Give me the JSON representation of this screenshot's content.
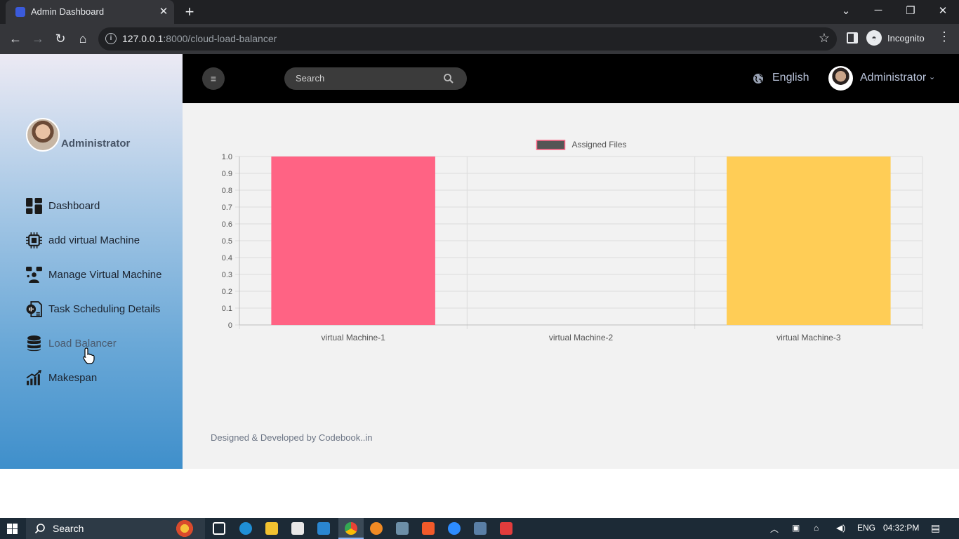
{
  "browser": {
    "tab_title": "Admin Dashboard",
    "url_host": "127.0.0.1",
    "url_rest": ":8000/cloud-load-balancer",
    "profile": "Incognito"
  },
  "sidebar": {
    "user_name": "Administrator",
    "items": [
      {
        "label": "Dashboard",
        "icon": "dashboard-icon"
      },
      {
        "label": "add virtual Machine",
        "icon": "chip-icon"
      },
      {
        "label": "Manage Virtual Machine",
        "icon": "users-manage-icon"
      },
      {
        "label": "Task Scheduling Details",
        "icon": "task-doc-icon"
      },
      {
        "label": "Load Balancer",
        "icon": "database-icon",
        "active": true
      },
      {
        "label": "Makespan",
        "icon": "growth-chart-icon"
      }
    ]
  },
  "header": {
    "search_placeholder": "Search",
    "language": "English",
    "user_name": "Administrator"
  },
  "chart_data": {
    "type": "bar",
    "categories": [
      "virtual Machine-1",
      "virtual Machine-2",
      "virtual Machine-3"
    ],
    "series": [
      {
        "name": "Assigned Files",
        "values": [
          1,
          0,
          1
        ],
        "colors": [
          "#ff6384",
          "#36a2eb",
          "#ffcd56"
        ]
      }
    ],
    "legend_color": "#555555",
    "legend_position": "top",
    "ylim": [
      0,
      1.0
    ],
    "yticks": [
      "1.0",
      "0.9",
      "0.8",
      "0.7",
      "0.6",
      "0.5",
      "0.4",
      "0.3",
      "0.2",
      "0.1",
      "0"
    ],
    "grid": true
  },
  "footer": {
    "text": "Designed & Developed by Codebook..in"
  },
  "taskbar": {
    "search_label": "Search",
    "language": "ENG",
    "time": "04:32:PM"
  },
  "colors": {
    "header_bg": "#000000",
    "main_bg": "#f2f2f2",
    "sidebar_top": "#eceaf4",
    "sidebar_bottom": "#3f8fcb"
  }
}
